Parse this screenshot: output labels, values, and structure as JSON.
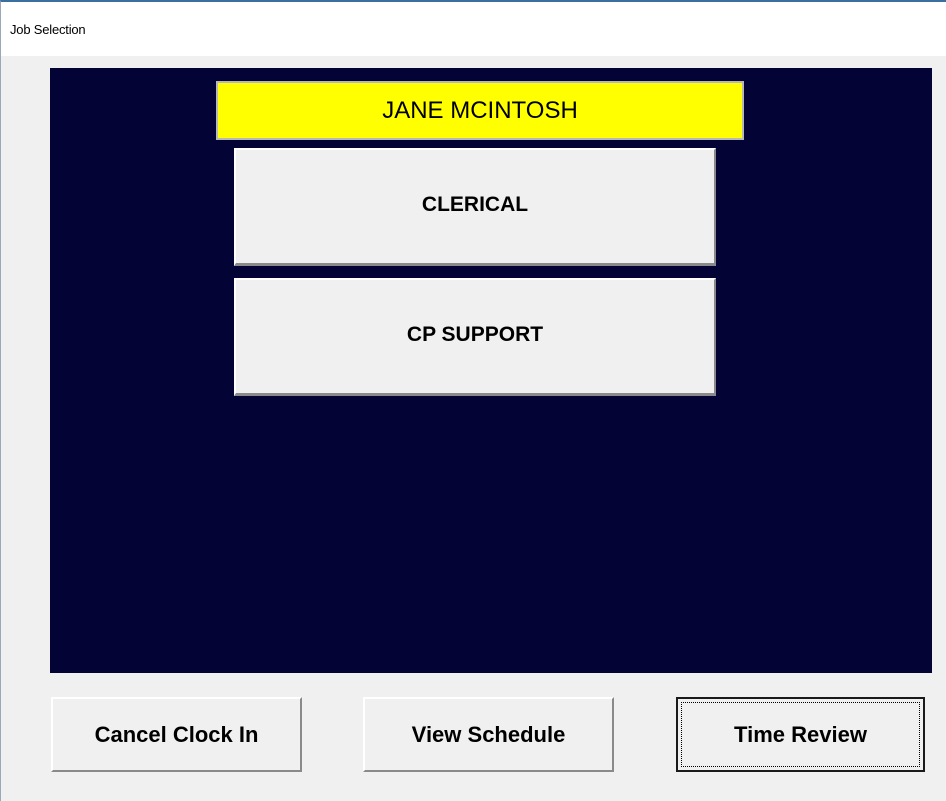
{
  "window": {
    "title": "Job Selection"
  },
  "employee": {
    "name": "JANE MCINTOSH"
  },
  "jobs": [
    {
      "label": "CLERICAL"
    },
    {
      "label": "CP SUPPORT"
    }
  ],
  "actions": {
    "cancel_clock_in": "Cancel Clock In",
    "view_schedule": "View Schedule",
    "time_review": "Time Review"
  },
  "colors": {
    "panel_background": "#030335",
    "name_highlight": "#ffff00",
    "button_face": "#f0f0f0"
  }
}
